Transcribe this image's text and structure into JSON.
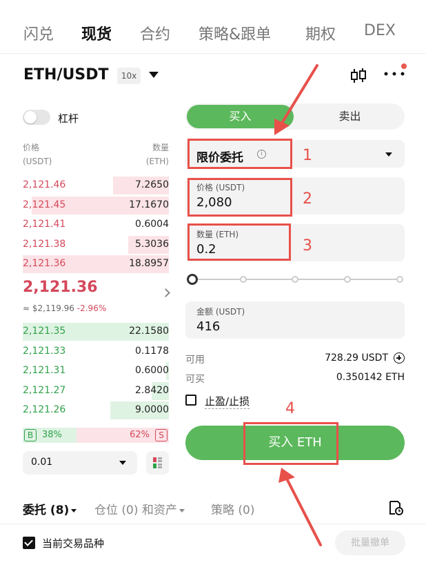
{
  "top_tabs": [
    "闪兑",
    "现货",
    "合约",
    "策略&跟单",
    "期权",
    "DEX"
  ],
  "header": {
    "pair": "ETH/USDT",
    "leverage": "10x"
  },
  "margin_toggle_label": "杠杆",
  "orderbook": {
    "price_header": "价格",
    "price_unit": "(USDT)",
    "qty_header": "数量",
    "qty_unit": "(ETH)",
    "asks": [
      {
        "price": "2,121.46",
        "qty": "7.2650",
        "depth": 0.38
      },
      {
        "price": "2,121.45",
        "qty": "17.1670",
        "depth": 0.94
      },
      {
        "price": "2,121.41",
        "qty": "0.6004",
        "depth": 0.0
      },
      {
        "price": "2,121.38",
        "qty": "5.3036",
        "depth": 0.28
      },
      {
        "price": "2,121.36",
        "qty": "18.8957",
        "depth": 1.0
      }
    ],
    "last_price": "2,121.36",
    "usd_price": "≈ $2,119.96",
    "change": "-2.96%",
    "bids": [
      {
        "price": "2,121.35",
        "qty": "22.1580",
        "depth": 1.0
      },
      {
        "price": "2,121.33",
        "qty": "0.1178",
        "depth": 0.0
      },
      {
        "price": "2,121.31",
        "qty": "0.6000",
        "depth": 0.02
      },
      {
        "price": "2,121.27",
        "qty": "2.8420",
        "depth": 0.12
      },
      {
        "price": "2,121.26",
        "qty": "9.0000",
        "depth": 0.4
      }
    ],
    "buy_ratio_badge": "B",
    "buy_ratio": "38%",
    "sell_ratio": "62%",
    "sell_ratio_badge": "S",
    "depth_value": "0.01"
  },
  "order_form": {
    "buy_tab": "买入",
    "sell_tab": "卖出",
    "order_type": "限价委托",
    "price_label": "价格 (USDT)",
    "price_value": "2,080",
    "qty_label": "数量 (ETH)",
    "qty_value": "0.2",
    "amount_label": "金额 (USDT)",
    "amount_value": "416",
    "available_label": "可用",
    "available_value": "728.29 USDT",
    "can_buy_label": "可买",
    "can_buy_value": "0.350142 ETH",
    "tpsl_label": "止盈/止损",
    "submit_label": "买入 ETH"
  },
  "bottom_tabs": {
    "orders": "委托 (8)",
    "positions": "仓位 (0) 和资产",
    "strategy": "策略 (0)"
  },
  "current_pair_filter": "当前交易品种",
  "batch_cancel": "批量撤单",
  "annotations": [
    "1",
    "2",
    "3",
    "4"
  ],
  "colors": {
    "buy_green": "#5cb85c",
    "ask_red": "#d4485a",
    "bid_green": "#2fa14a",
    "annotation_red": "#e8504a"
  }
}
